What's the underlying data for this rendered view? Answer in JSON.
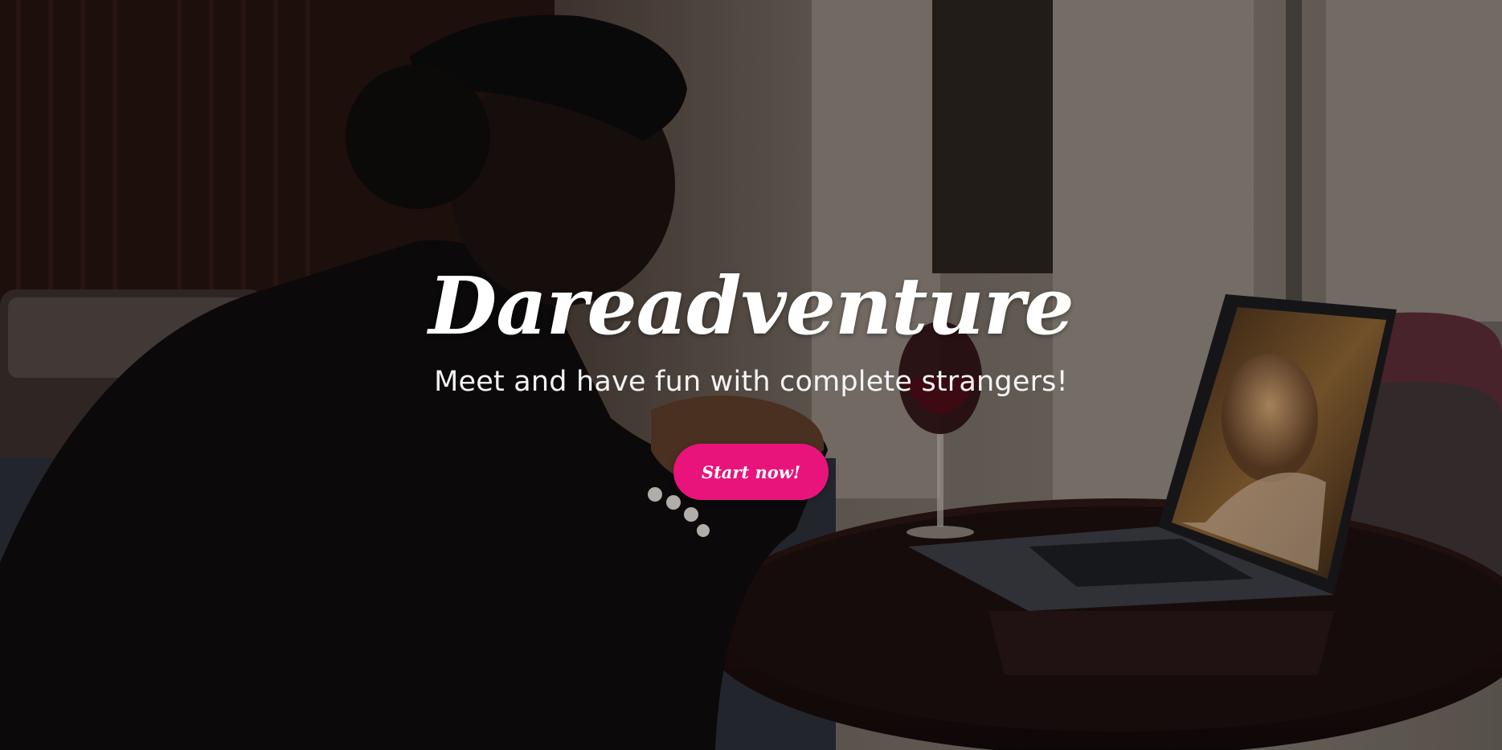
{
  "hero": {
    "title": "Dareadventure",
    "subtitle": "Meet and have fun with complete strangers!",
    "cta_label": "Start now!"
  },
  "colors": {
    "accent": "#e8147b",
    "text": "#ffffff"
  },
  "background": {
    "image": "hero-background-photo"
  }
}
